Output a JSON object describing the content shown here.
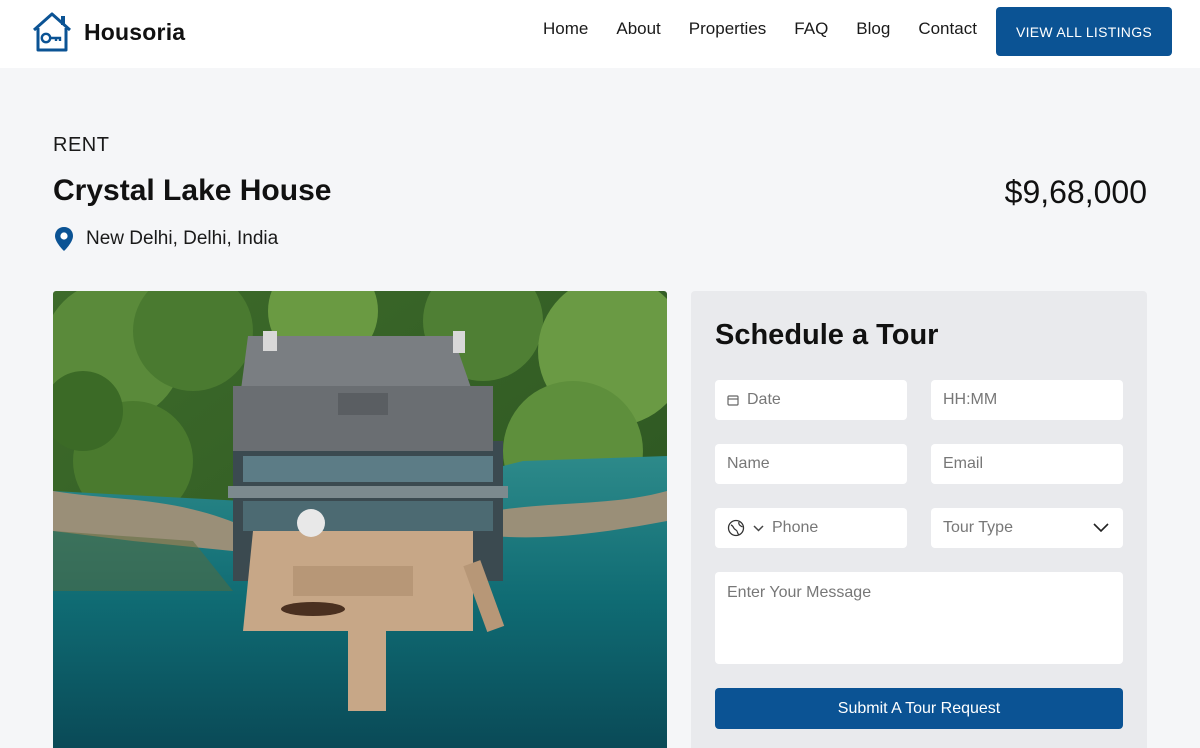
{
  "brand": {
    "name": "Housoria",
    "logo_icon": "house-key-logo-icon",
    "accent": "#0b5394"
  },
  "nav": {
    "items": [
      "Home",
      "About",
      "Properties",
      "FAQ",
      "Blog",
      "Contact"
    ],
    "cta_label": "VIEW ALL LISTINGS"
  },
  "listing": {
    "badge": "RENT",
    "title": "Crystal Lake House",
    "price": "$9,68,000",
    "location": "New Delhi, Delhi, India",
    "location_icon": "map-pin-icon"
  },
  "tour_form": {
    "title": "Schedule a Tour",
    "date_placeholder": "Date",
    "time_placeholder": "HH:MM",
    "name_placeholder": "Name",
    "email_placeholder": "Email",
    "phone_placeholder": "Phone",
    "tour_type_placeholder": "Tour Type",
    "message_placeholder": "Enter Your Message",
    "submit_label": "Submit A Tour Request"
  }
}
